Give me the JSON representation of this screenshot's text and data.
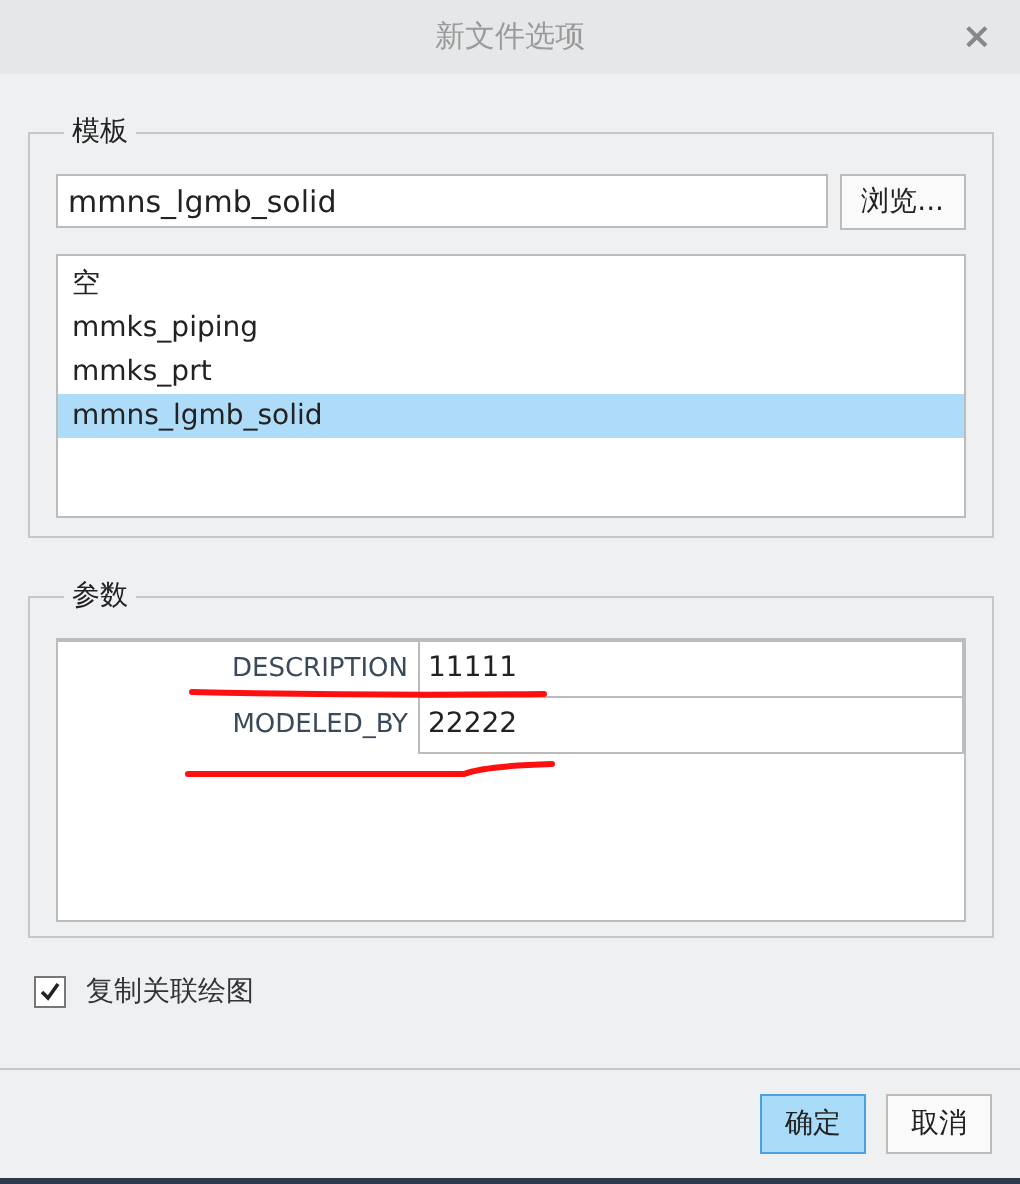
{
  "window": {
    "title": "新文件选项",
    "close": "×"
  },
  "template": {
    "legend": "模板",
    "value": "mmns_lgmb_solid",
    "browse": "浏览...",
    "items": [
      {
        "label": "空",
        "selected": false
      },
      {
        "label": "mmks_piping",
        "selected": false
      },
      {
        "label": "mmks_prt",
        "selected": false
      },
      {
        "label": "mmns_lgmb_solid",
        "selected": true
      }
    ]
  },
  "parameters": {
    "legend": "参数",
    "rows": [
      {
        "name": "DESCRIPTION",
        "value": "11111"
      },
      {
        "name": "MODELED_BY",
        "value": "22222"
      }
    ]
  },
  "copy_drawing": {
    "label": "复制关联绘图",
    "checked": true
  },
  "buttons": [
    {
      "label": "确定",
      "selected": true
    },
    {
      "label": "取消",
      "selected": false
    }
  ]
}
